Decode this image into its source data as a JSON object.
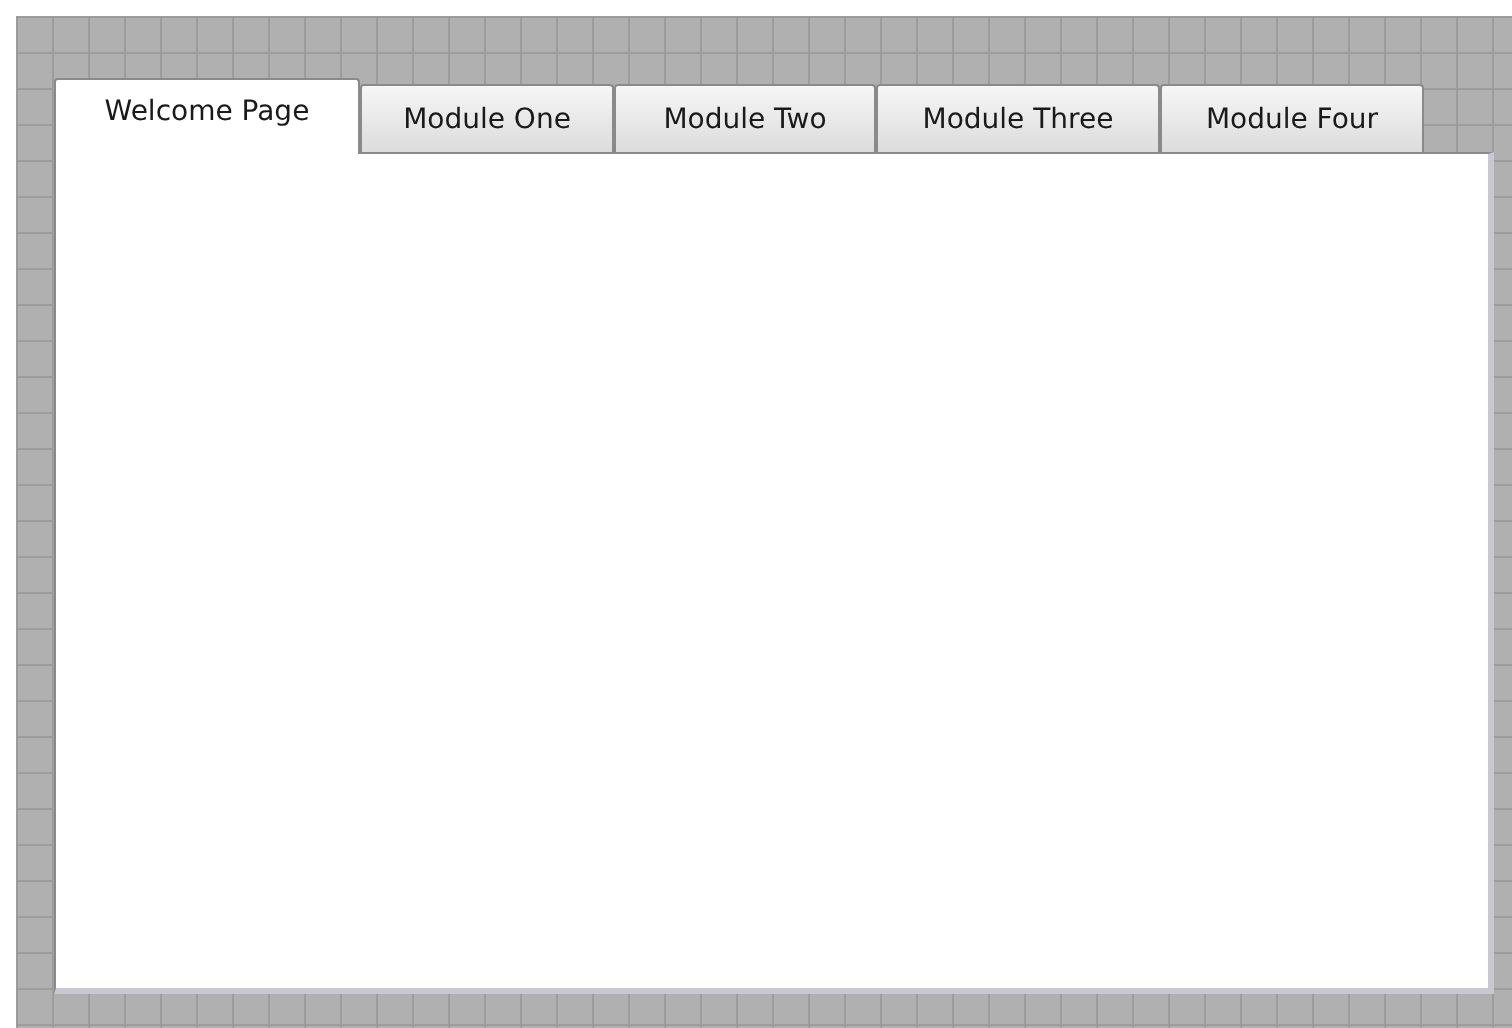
{
  "tabs": [
    {
      "label": "Welcome Page",
      "selected": true
    },
    {
      "label": "Module One",
      "selected": false
    },
    {
      "label": "Module Two",
      "selected": false
    },
    {
      "label": "Module Three",
      "selected": false
    },
    {
      "label": "Module Four",
      "selected": false
    }
  ]
}
